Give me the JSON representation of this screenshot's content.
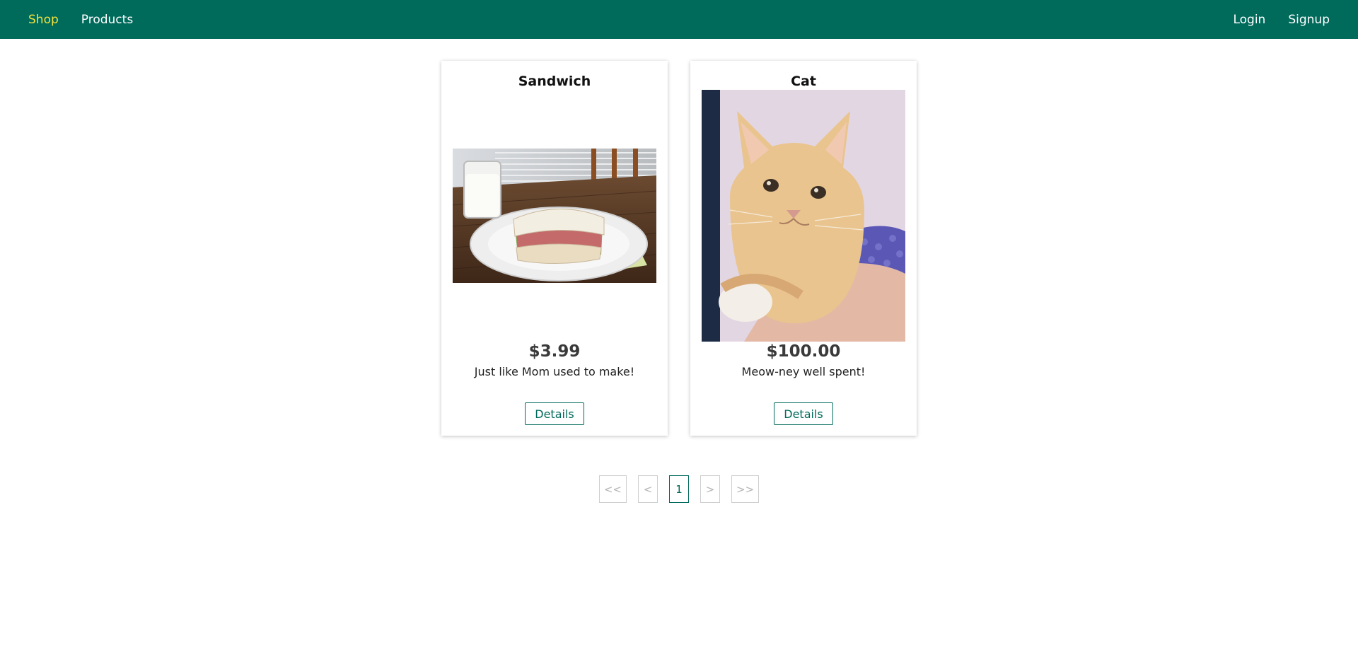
{
  "nav": {
    "left": [
      {
        "label": "Shop",
        "active": true
      },
      {
        "label": "Products",
        "active": false
      }
    ],
    "right": [
      {
        "label": "Login"
      },
      {
        "label": "Signup"
      }
    ]
  },
  "products": [
    {
      "title": "Sandwich",
      "price": "$3.99",
      "description": "Just like Mom used to make!",
      "details_label": "Details",
      "image": "sandwich-photo"
    },
    {
      "title": "Cat",
      "price": "$100.00",
      "description": "Meow-ney well spent!",
      "details_label": "Details",
      "image": "cat-photo"
    }
  ],
  "pagination": {
    "first": "<<",
    "prev": "<",
    "current": "1",
    "next": ">",
    "last": ">>"
  },
  "colors": {
    "brand": "#006a5b",
    "active_nav": "#f2e33b"
  }
}
